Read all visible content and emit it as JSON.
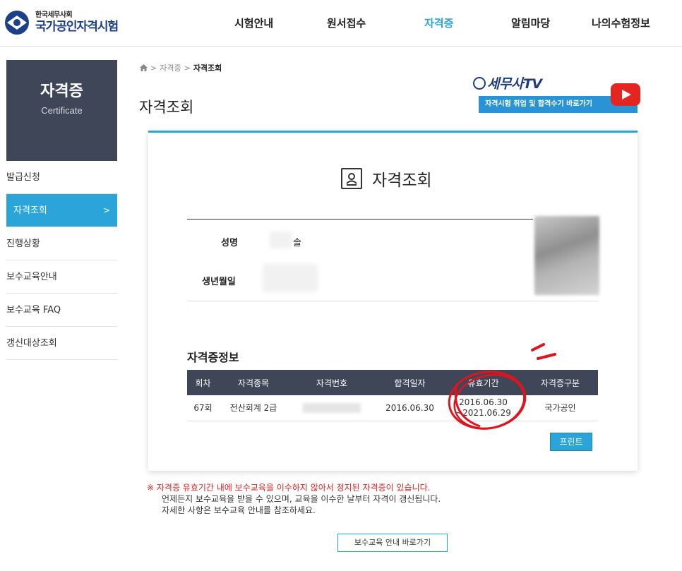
{
  "header": {
    "logo_small": "한국세무사회",
    "logo_big": "국가공인자격시험",
    "nav": [
      {
        "label": "시험안내",
        "active": false
      },
      {
        "label": "원서접수",
        "active": false
      },
      {
        "label": "자격증",
        "active": true
      },
      {
        "label": "알림마당",
        "active": false
      },
      {
        "label": "나의수험정보",
        "active": false
      }
    ]
  },
  "sidebar": {
    "hero_title": "자격증",
    "hero_subtitle": "Certificate",
    "items": [
      {
        "label": "발급신청",
        "active": false
      },
      {
        "label": "자격조회",
        "active": true,
        "chevron": ">"
      },
      {
        "label": "진행상황",
        "active": false
      },
      {
        "label": "보수교육안내",
        "active": false
      },
      {
        "label": "보수교육 FAQ",
        "active": false
      },
      {
        "label": "갱신대상조회",
        "active": false
      }
    ]
  },
  "breadcrumb": {
    "sep": ">",
    "parent": "자격증",
    "current": "자격조회"
  },
  "page_title": "자격조회",
  "tv_banner": {
    "logo": "세무사TV",
    "caption": "자격시험 취업 및 합격수기 바로가기"
  },
  "card": {
    "title": "자격조회",
    "name_label": "성명",
    "name_suffix": "솔",
    "birth_label": "생년월일",
    "section_title": "자격증정보",
    "table": {
      "headers": [
        "회차",
        "자격종목",
        "자격번호",
        "합격일자",
        "유효기간",
        "자격증구분"
      ],
      "rows": [
        {
          "round": "67회",
          "type": "전산회계 2급",
          "number": "",
          "pass_date": "2016.06.30",
          "valid_from": "2016.06.30",
          "valid_to": "~2021.06.29",
          "category": "국가공인"
        }
      ]
    },
    "print_label": "프린트"
  },
  "notice": {
    "line1": "※ 자격증 유효기간 내에 보수교육을 이수하지 않아서 정지된 자격증이 있습니다.",
    "line2": "언제든지 보수교육을 받을 수 있으며, 교육을 이수한 날부터 자격이 갱신됩니다.",
    "line3": "자세한 사항은 보수교육 안내를 참조하세요."
  },
  "guide_button": "보수교육 안내 바로가기",
  "colors": {
    "accent": "#2aa4d9",
    "sidebar_dark": "#3e4657",
    "notice_red": "#e02222",
    "annotation_red": "#e0141e"
  }
}
